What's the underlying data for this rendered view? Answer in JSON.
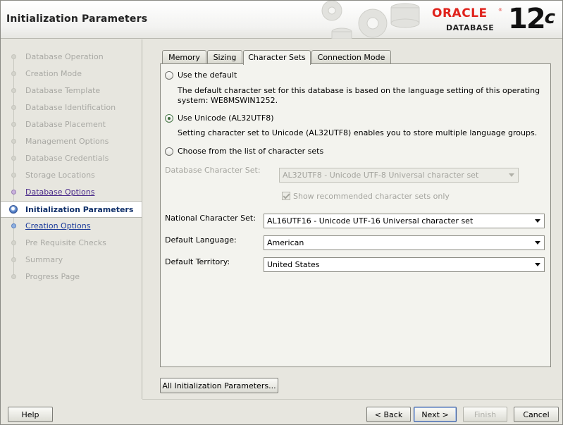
{
  "header": {
    "title": "Initialization Parameters",
    "brand": "ORACLE",
    "brand_product": "DATABASE",
    "version_number": "12",
    "version_suffix": "c"
  },
  "sidebar": {
    "items": [
      {
        "label": "Database Operation",
        "state": "disabled"
      },
      {
        "label": "Creation Mode",
        "state": "disabled"
      },
      {
        "label": "Database Template",
        "state": "disabled"
      },
      {
        "label": "Database Identification",
        "state": "disabled"
      },
      {
        "label": "Database Placement",
        "state": "disabled"
      },
      {
        "label": "Management Options",
        "state": "disabled"
      },
      {
        "label": "Database Credentials",
        "state": "disabled"
      },
      {
        "label": "Storage Locations",
        "state": "disabled"
      },
      {
        "label": "Database Options",
        "state": "visited"
      },
      {
        "label": "Initialization Parameters",
        "state": "active"
      },
      {
        "label": "Creation Options",
        "state": "link"
      },
      {
        "label": "Pre Requisite Checks",
        "state": "disabled"
      },
      {
        "label": "Summary",
        "state": "disabled"
      },
      {
        "label": "Progress Page",
        "state": "disabled"
      }
    ]
  },
  "tabs": [
    {
      "label": "Memory",
      "selected": false
    },
    {
      "label": "Sizing",
      "selected": false
    },
    {
      "label": "Character Sets",
      "selected": true
    },
    {
      "label": "Connection Mode",
      "selected": false
    }
  ],
  "charset": {
    "option_default": {
      "label": "Use the default",
      "description_line1": "The default character set for this database is based on the language setting of this operating",
      "description_line2": "system: WE8MSWIN1252.",
      "checked": false
    },
    "option_unicode": {
      "label": "Use Unicode (AL32UTF8)",
      "description": "Setting character set to Unicode (AL32UTF8) enables you to store multiple language groups.",
      "checked": true
    },
    "option_list": {
      "label": "Choose from the list of character sets",
      "checked": false
    },
    "db_charset_label": "Database Character Set:",
    "db_charset_value": "AL32UTF8 - Unicode UTF-8 Universal character set",
    "show_recommended_label": "Show recommended character sets only",
    "show_recommended_checked": true,
    "national_label": "National Character Set:",
    "national_value": "AL16UTF16 - Unicode UTF-16 Universal character set",
    "language_label": "Default Language:",
    "language_value": "American",
    "territory_label": "Default Territory:",
    "territory_value": "United States"
  },
  "buttons": {
    "all_params": "All Initialization Parameters...",
    "help": "Help",
    "back": "< Back",
    "next": "Next >",
    "finish": "Finish",
    "cancel": "Cancel"
  }
}
